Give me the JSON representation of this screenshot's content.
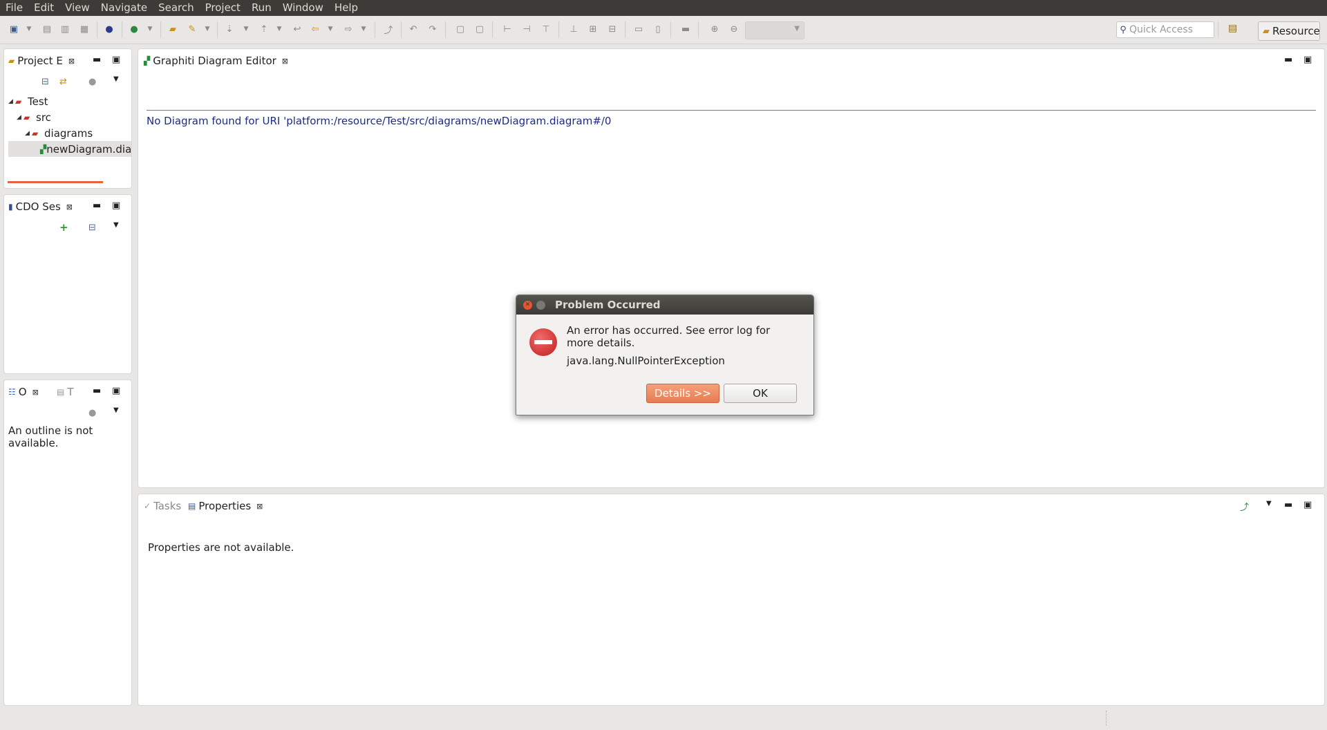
{
  "menu": [
    "File",
    "Edit",
    "View",
    "Navigate",
    "Search",
    "Project",
    "Run",
    "Window",
    "Help"
  ],
  "toolbar": {
    "quick_access_placeholder": "Quick Access",
    "perspective_label": "Resource"
  },
  "project_explorer": {
    "tab_label": "Project E",
    "tree": [
      {
        "label": "Test",
        "level": 0,
        "expanded": true
      },
      {
        "label": "src",
        "level": 1,
        "expanded": true
      },
      {
        "label": "diagrams",
        "level": 2,
        "expanded": true
      },
      {
        "label": "newDiagram.dia",
        "level": 3,
        "selected": true
      }
    ]
  },
  "cdo_sessions": {
    "tab_label": "CDO Ses"
  },
  "outline": {
    "tab_outline": "O",
    "tab_t": "T",
    "message": "An outline is not available."
  },
  "editor": {
    "tab_label": "Graphiti Diagram Editor",
    "message": "No Diagram found for URI 'platform:/resource/Test/src/diagrams/newDiagram.diagram#/0"
  },
  "bottom": {
    "tab_tasks": "Tasks",
    "tab_properties": "Properties",
    "message": "Properties are not available."
  },
  "dialog": {
    "title": "Problem Occurred",
    "message": "An error has occurred. See error log for more details.",
    "exception": "java.lang.NullPointerException",
    "details_button": "Details >>",
    "ok_button": "OK"
  },
  "colors": {
    "menubar": "#3c3b37",
    "error_text": "#1c2a8c",
    "details_button": "#f08a5d"
  }
}
